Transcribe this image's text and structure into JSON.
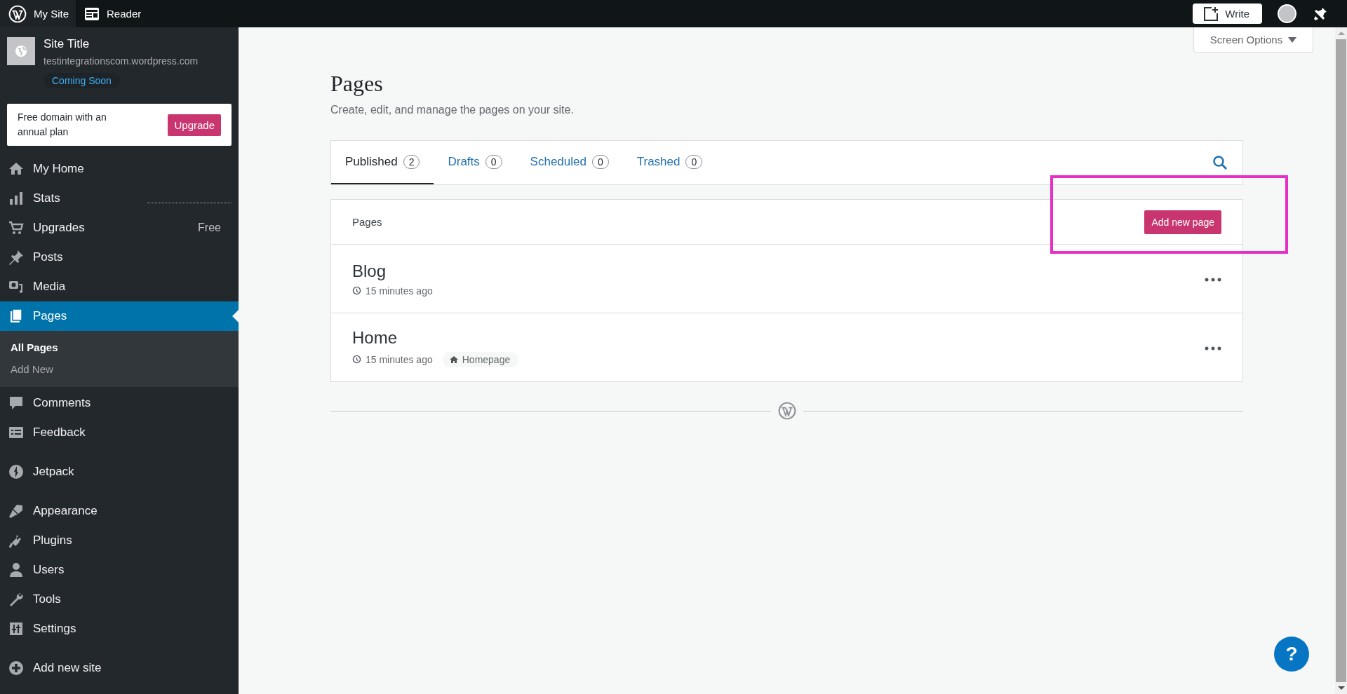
{
  "topbar": {
    "tabs": [
      {
        "label": "My Site",
        "selected": true
      },
      {
        "label": "Reader",
        "selected": false
      }
    ],
    "write_button": "Write"
  },
  "sidebar": {
    "site": {
      "title": "Site Title",
      "domain": "testintegrationscom.wordpress.com",
      "status": "Coming Soon"
    },
    "promo": {
      "text": "Free domain with an annual plan",
      "button": "Upgrade"
    },
    "groups": [
      [
        {
          "label": "My Home",
          "selected": false
        },
        {
          "label": "Stats",
          "selected": false
        },
        {
          "label": "Upgrades",
          "selected": false,
          "badge": "Free"
        },
        {
          "label": "Posts",
          "selected": false
        },
        {
          "label": "Media",
          "selected": false
        },
        {
          "label": "Pages",
          "selected": true,
          "expanded": true,
          "children": [
            {
              "label": "All Pages",
              "selected": true
            },
            {
              "label": "Add New",
              "selected": false
            }
          ]
        },
        {
          "label": "Comments",
          "selected": false
        },
        {
          "label": "Feedback",
          "selected": false
        }
      ],
      [
        {
          "label": "Jetpack",
          "selected": false
        }
      ],
      [
        {
          "label": "Appearance",
          "selected": false
        },
        {
          "label": "Plugins",
          "selected": false
        },
        {
          "label": "Users",
          "selected": false
        },
        {
          "label": "Tools",
          "selected": false
        },
        {
          "label": "Settings",
          "selected": false
        }
      ],
      [
        {
          "label": "Add new site",
          "selected": false
        }
      ]
    ]
  },
  "screen_options": "Screen Options",
  "header": {
    "title": "Pages",
    "subtitle": "Create, edit, and manage the pages on your site."
  },
  "tabs": [
    {
      "label": "Published",
      "count": "2",
      "selected": true
    },
    {
      "label": "Drafts",
      "count": "0",
      "selected": false
    },
    {
      "label": "Scheduled",
      "count": "0",
      "selected": false
    },
    {
      "label": "Trashed",
      "count": "0",
      "selected": false
    }
  ],
  "list": {
    "heading": "Pages",
    "add_button": "Add new page",
    "rows": [
      {
        "title": "Blog",
        "time": "15 minutes ago"
      },
      {
        "title": "Home",
        "time": "15 minutes ago",
        "badge": "Homepage"
      }
    ]
  },
  "help_button": "?"
}
